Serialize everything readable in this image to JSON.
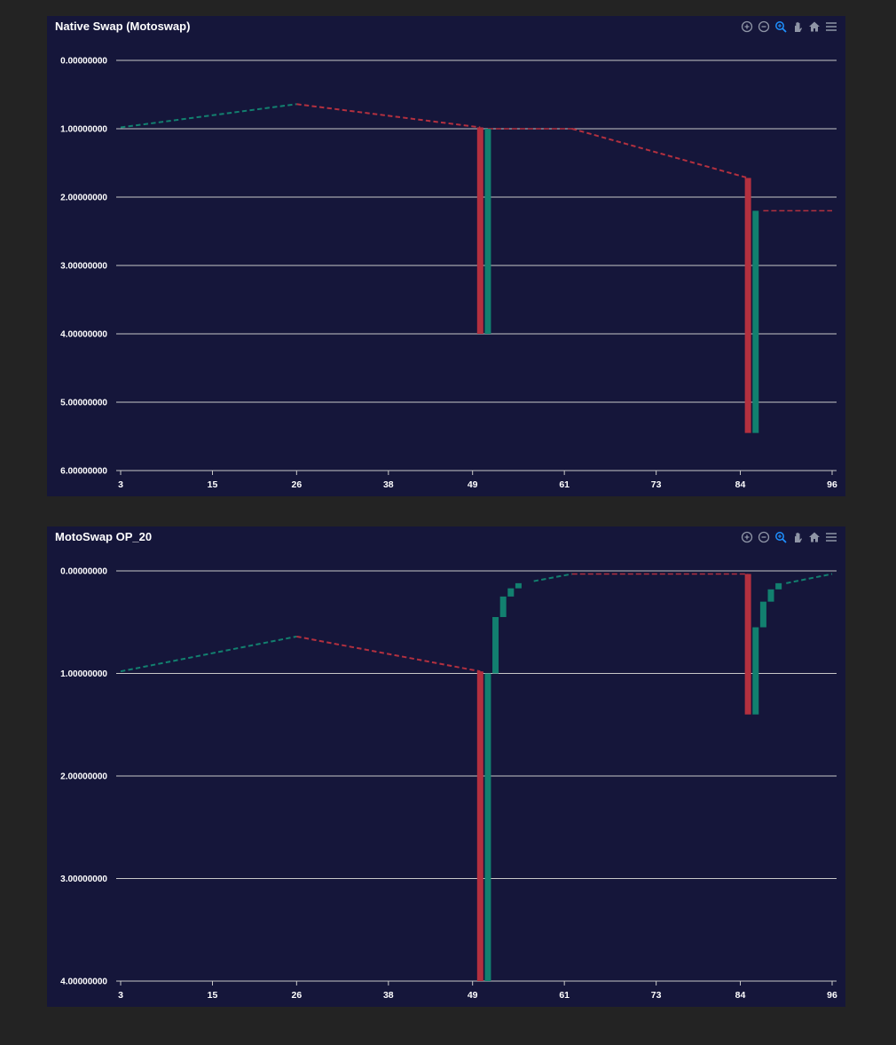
{
  "colors": {
    "page_bg": "#232323",
    "panel_bg": "#15163a",
    "grid": "#c8c8c8",
    "red": "#b3303f",
    "green": "#12806f",
    "icon": "#8f95a6",
    "icon_active": "#1e90ff"
  },
  "toolbar": {
    "icons": [
      "zoom-in-icon",
      "zoom-out-icon",
      "selection-zoom-icon",
      "pan-hand-icon",
      "reset-home-icon",
      "menu-icon"
    ]
  },
  "chart_data": [
    {
      "type": "candlestick",
      "title": "Native Swap (Motoswap)",
      "y_inverted": true,
      "ylim": [
        0,
        6
      ],
      "ytick_values": [
        0,
        1,
        2,
        3,
        4,
        5,
        6
      ],
      "yticks": [
        "0.00000000",
        "1.00000000",
        "2.00000000",
        "3.00000000",
        "4.00000000",
        "5.00000000",
        "6.00000000"
      ],
      "xlim": [
        3,
        96
      ],
      "xtick_values": [
        3,
        15,
        26,
        38,
        49,
        61,
        73,
        84,
        96
      ],
      "xticks": [
        "3",
        "15",
        "26",
        "38",
        "49",
        "61",
        "73",
        "84",
        "96"
      ],
      "dashes": [
        {
          "from": 3,
          "to": 26,
          "start": 0.98,
          "end": 0.64,
          "color": "green",
          "style": "step"
        },
        {
          "from": 26,
          "to": 50,
          "start": 0.64,
          "end": 0.98,
          "color": "red",
          "style": "step"
        },
        {
          "from": 51,
          "to": 62,
          "start": 1.0,
          "end": 1.0,
          "color": "red",
          "style": "dashed"
        },
        {
          "from": 62,
          "to": 85,
          "start": 1.0,
          "end": 1.72,
          "color": "red",
          "style": "step"
        },
        {
          "from": 87,
          "to": 96,
          "start": 2.2,
          "end": 2.2,
          "color": "red",
          "style": "dashed"
        }
      ],
      "candles": [
        {
          "x": 50,
          "open": 0.98,
          "close": 4.0,
          "color": "red"
        },
        {
          "x": 51,
          "open": 4.0,
          "close": 1.0,
          "color": "green"
        },
        {
          "x": 85,
          "open": 1.72,
          "close": 5.45,
          "color": "red"
        },
        {
          "x": 86,
          "open": 5.45,
          "close": 2.2,
          "color": "green"
        }
      ]
    },
    {
      "type": "candlestick",
      "title": "MotoSwap OP_20",
      "y_inverted": true,
      "ylim": [
        0,
        4
      ],
      "ytick_values": [
        0,
        1,
        2,
        3,
        4
      ],
      "yticks": [
        "0.00000000",
        "1.00000000",
        "2.00000000",
        "3.00000000",
        "4.00000000"
      ],
      "xlim": [
        3,
        96
      ],
      "xtick_values": [
        3,
        15,
        26,
        38,
        49,
        61,
        73,
        84,
        96
      ],
      "xticks": [
        "3",
        "15",
        "26",
        "38",
        "49",
        "61",
        "73",
        "84",
        "96"
      ],
      "dashes": [
        {
          "from": 3,
          "to": 26,
          "start": 0.98,
          "end": 0.64,
          "color": "green",
          "style": "step"
        },
        {
          "from": 26,
          "to": 50,
          "start": 0.64,
          "end": 0.98,
          "color": "red",
          "style": "step"
        },
        {
          "from": 57,
          "to": 62,
          "start": 0.1,
          "end": 0.03,
          "color": "green",
          "style": "step"
        },
        {
          "from": 62,
          "to": 85,
          "start": 0.03,
          "end": 0.03,
          "color": "red",
          "style": "dashed"
        },
        {
          "from": 90,
          "to": 96,
          "start": 0.12,
          "end": 0.03,
          "color": "green",
          "style": "step"
        }
      ],
      "candles": [
        {
          "x": 50,
          "open": 0.98,
          "close": 4.0,
          "color": "red"
        },
        {
          "x": 51,
          "open": 4.0,
          "close": 1.0,
          "color": "green"
        },
        {
          "x": 52,
          "open": 1.0,
          "close": 0.45,
          "color": "green"
        },
        {
          "x": 53,
          "open": 0.45,
          "close": 0.25,
          "color": "green"
        },
        {
          "x": 54,
          "open": 0.25,
          "close": 0.17,
          "color": "green"
        },
        {
          "x": 55,
          "open": 0.17,
          "close": 0.12,
          "color": "green"
        },
        {
          "x": 85,
          "open": 0.03,
          "close": 1.4,
          "color": "red"
        },
        {
          "x": 86,
          "open": 1.4,
          "close": 0.55,
          "color": "green"
        },
        {
          "x": 87,
          "open": 0.55,
          "close": 0.3,
          "color": "green"
        },
        {
          "x": 88,
          "open": 0.3,
          "close": 0.18,
          "color": "green"
        },
        {
          "x": 89,
          "open": 0.18,
          "close": 0.12,
          "color": "green"
        }
      ]
    }
  ]
}
